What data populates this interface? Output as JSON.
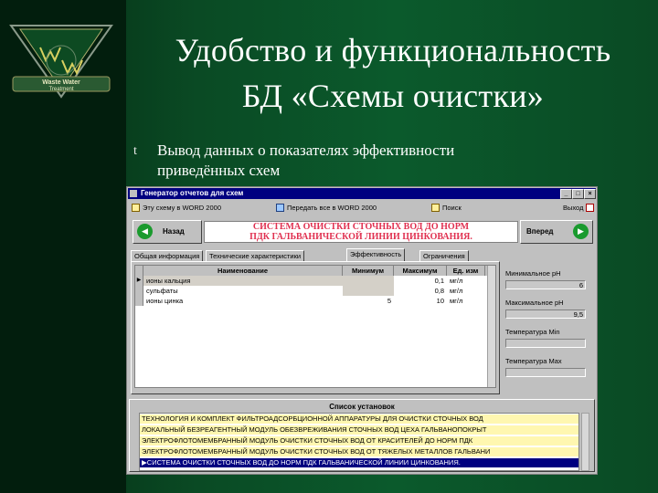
{
  "slide": {
    "title_line1": "Удобство и функциональность",
    "title_line2": "БД «Схемы очистки»",
    "bullet_mark": "t",
    "bullet_text": "Вывод данных о показателях эффективности приведённых схем",
    "logo_text_top": "Waste Water",
    "logo_text_bottom": "Treatment"
  },
  "window": {
    "title": "Генератор отчетов для схем",
    "buttons": {
      "minimize": "_",
      "maximize": "□",
      "close": "×"
    }
  },
  "toolbar": {
    "send_scheme": "Эту схему в WORD 2000",
    "send_all": "Передать все в WORD 2000",
    "search": "Поиск",
    "exit": "Выход"
  },
  "nav": {
    "back": "Назад",
    "forward": "Вперед",
    "back_arrow": "◀",
    "forward_arrow": "▶",
    "scheme_line1": "СИСТЕМА ОЧИСТКИ СТОЧНЫХ ВОД ДО НОРМ",
    "scheme_line2": "ПДК ГАЛЬВАНИЧЕСКОЙ ЛИНИИ ЦИНКОВАНИЯ."
  },
  "tabs": [
    "Общая информация",
    "Технические характеристики",
    "Эффективность",
    "Ограничения"
  ],
  "table": {
    "headers": {
      "name": "Наименование",
      "min": "Минимум",
      "max": "Максимум",
      "unit": "Ед. изм"
    },
    "rows": [
      {
        "name": "ионы кальция",
        "min": "",
        "max": "0,1",
        "unit": "мг/л"
      },
      {
        "name": "сульфаты",
        "min": "",
        "max": "0,8",
        "unit": "мг/л"
      },
      {
        "name": "ионы цинка",
        "min": "5",
        "max": "10",
        "unit": "мг/л"
      }
    ]
  },
  "side": {
    "ph_min_label": "Минимальное pH",
    "ph_min_value": "6",
    "ph_max_label": "Максимальное pH",
    "ph_max_value": "9,5",
    "temp_min_label": "Температура Min",
    "temp_min_value": "",
    "temp_max_label": "Температура Max",
    "temp_max_value": ""
  },
  "install_list": {
    "title": "Список установок",
    "items": [
      "ТЕХНОЛОГИЯ И КОМПЛЕКТ ФИЛЬТРОАДСОРБЦИОННОЙ АППАРАТУРЫ ДЛЯ ОЧИСТКИ СТОЧНЫХ ВОД",
      "ЛОКАЛЬНЫЙ БЕЗРЕАГЕНТНЫЙ МОДУЛЬ ОБЕЗВРЕЖИВАНИЯ СТОЧНЫХ ВОД ЦЕХА ГАЛЬВАНОПОКРЫТ",
      "ЭЛЕКТРОФЛОТОМЕМБРАННЫЙ МОДУЛЬ ОЧИСТКИ СТОЧНЫХ ВОД ОТ КРАСИТЕЛЕЙ ДО НОРМ ПДК",
      "ЭЛЕКТРОФЛОТОМЕМБРАННЫЙ МОДУЛЬ ОЧИСТКИ СТОЧНЫХ ВОД ОТ ТЯЖЕЛЫХ МЕТАЛЛОВ ГАЛЬВАНИ",
      "СИСТЕМА ОЧИСТКИ СТОЧНЫХ ВОД ДО НОРМ ПДК ГАЛЬВАНИЧЕСКОЙ ЛИНИИ ЦИНКОВАНИЯ."
    ],
    "selected_index": 4,
    "selected_marker": "▶"
  }
}
